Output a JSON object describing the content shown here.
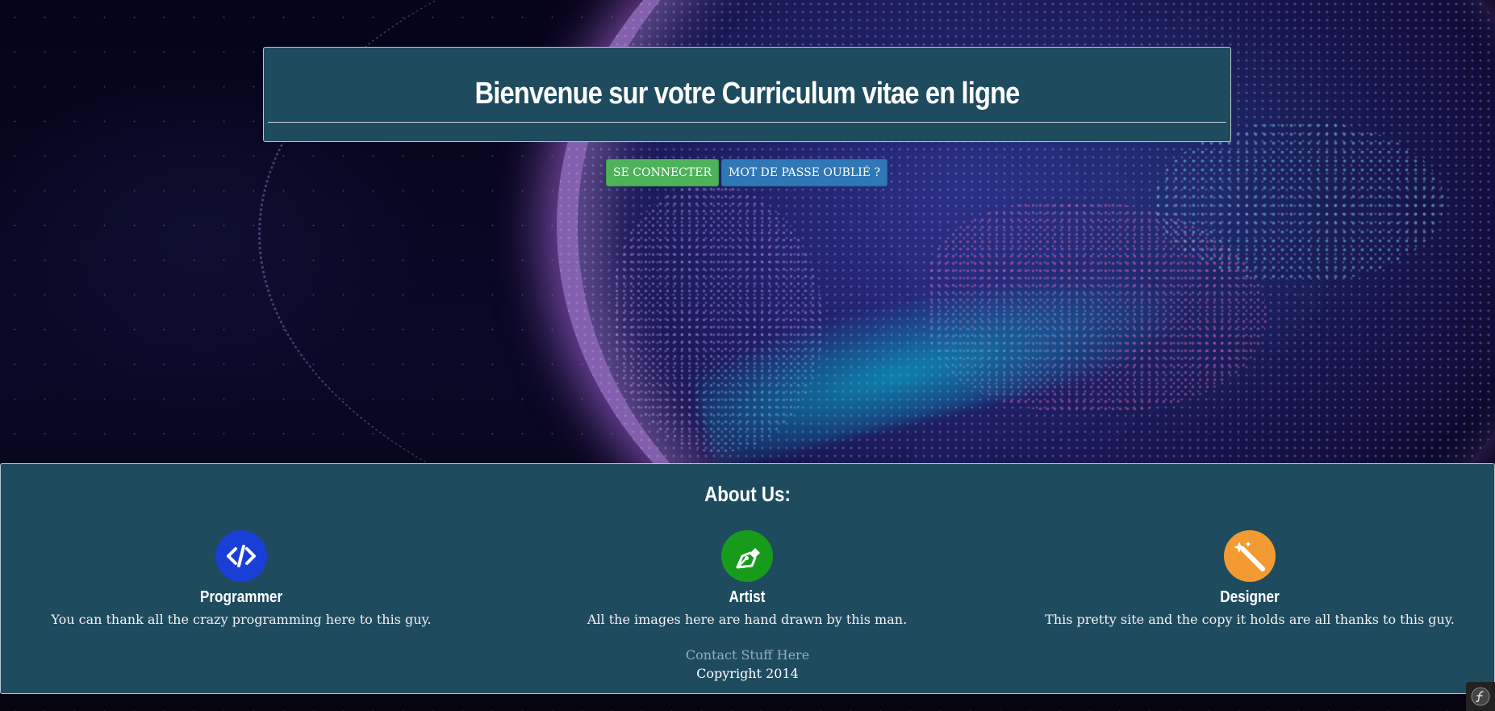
{
  "header": {
    "title": "Bienvenue sur votre Curriculum vitae en ligne"
  },
  "actions": {
    "login_label": "SE CONNECTER",
    "forgot_label": "MOT DE PASSE OUBLIÉ ?"
  },
  "about": {
    "title": "About Us:",
    "members": [
      {
        "icon": "code-icon",
        "icon_color": "#1a3fd6",
        "name": "Programmer",
        "description": "You can thank all the crazy programming here to this guy."
      },
      {
        "icon": "pen-nib-icon",
        "icon_color": "#169c1a",
        "name": "Artist",
        "description": "All the images here are hand drawn by this man."
      },
      {
        "icon": "magic-wand-icon",
        "icon_color": "#f39b32",
        "name": "Designer",
        "description": "This pretty site and the copy it holds are all thanks to this guy."
      }
    ],
    "contact": "Contact Stuff Here",
    "copyright": "Copyright 2014"
  },
  "colors": {
    "panel": "#1f4b5e",
    "login_button": "#4eb25a",
    "forgot_button": "#2f77b5"
  }
}
